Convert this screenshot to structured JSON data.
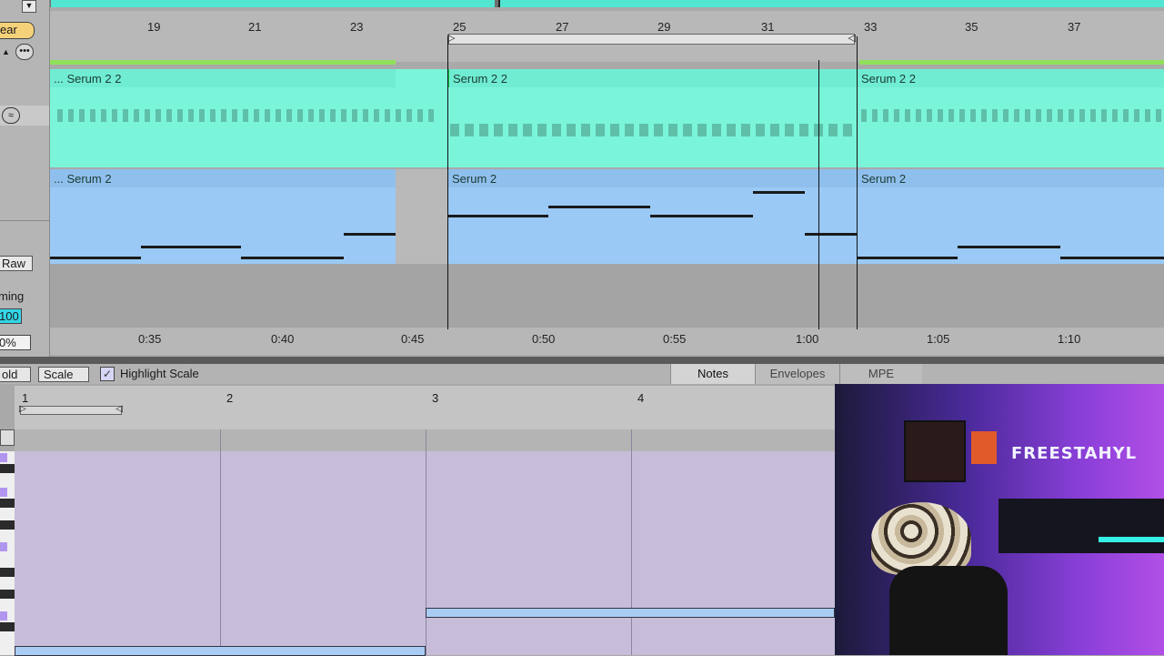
{
  "left_panel": {
    "clear_label": "ear",
    "raw_label": "Raw",
    "timing_label": "ming",
    "timing_value": "100",
    "percent_value": "0%"
  },
  "arrangement": {
    "bar_numbers": [
      "19",
      "21",
      "23",
      "25",
      "27",
      "29",
      "31",
      "33",
      "35",
      "37"
    ],
    "track1": {
      "clips": [
        {
          "title": "... Serum 2 2"
        },
        {
          "title": "Serum 2 2"
        },
        {
          "title": "Serum 2 2"
        }
      ]
    },
    "track2": {
      "clips": [
        {
          "title": "... Serum 2"
        },
        {
          "title": "Serum 2"
        },
        {
          "title": "Serum 2"
        }
      ]
    },
    "time_labels": [
      "0:35",
      "0:40",
      "0:45",
      "0:50",
      "0:55",
      "1:00",
      "1:05",
      "1:10"
    ]
  },
  "toolbar": {
    "fold_label": "old",
    "scale_label": "Scale",
    "highlight_scale_label": "Highlight Scale",
    "highlight_scale_checked": "✓",
    "tabs": [
      {
        "label": "Notes"
      },
      {
        "label": "Envelopes"
      },
      {
        "label": "MPE"
      }
    ]
  },
  "clip_editor": {
    "bar_numbers": [
      "1",
      "2",
      "3",
      "4"
    ]
  },
  "webcam": {
    "brand_text": "FREESTAHYL"
  },
  "colors": {
    "track1_clip": "#7bf5d9",
    "track2_clip": "#9bc9f5",
    "clip_editor_grid": "#c7bdd8"
  }
}
